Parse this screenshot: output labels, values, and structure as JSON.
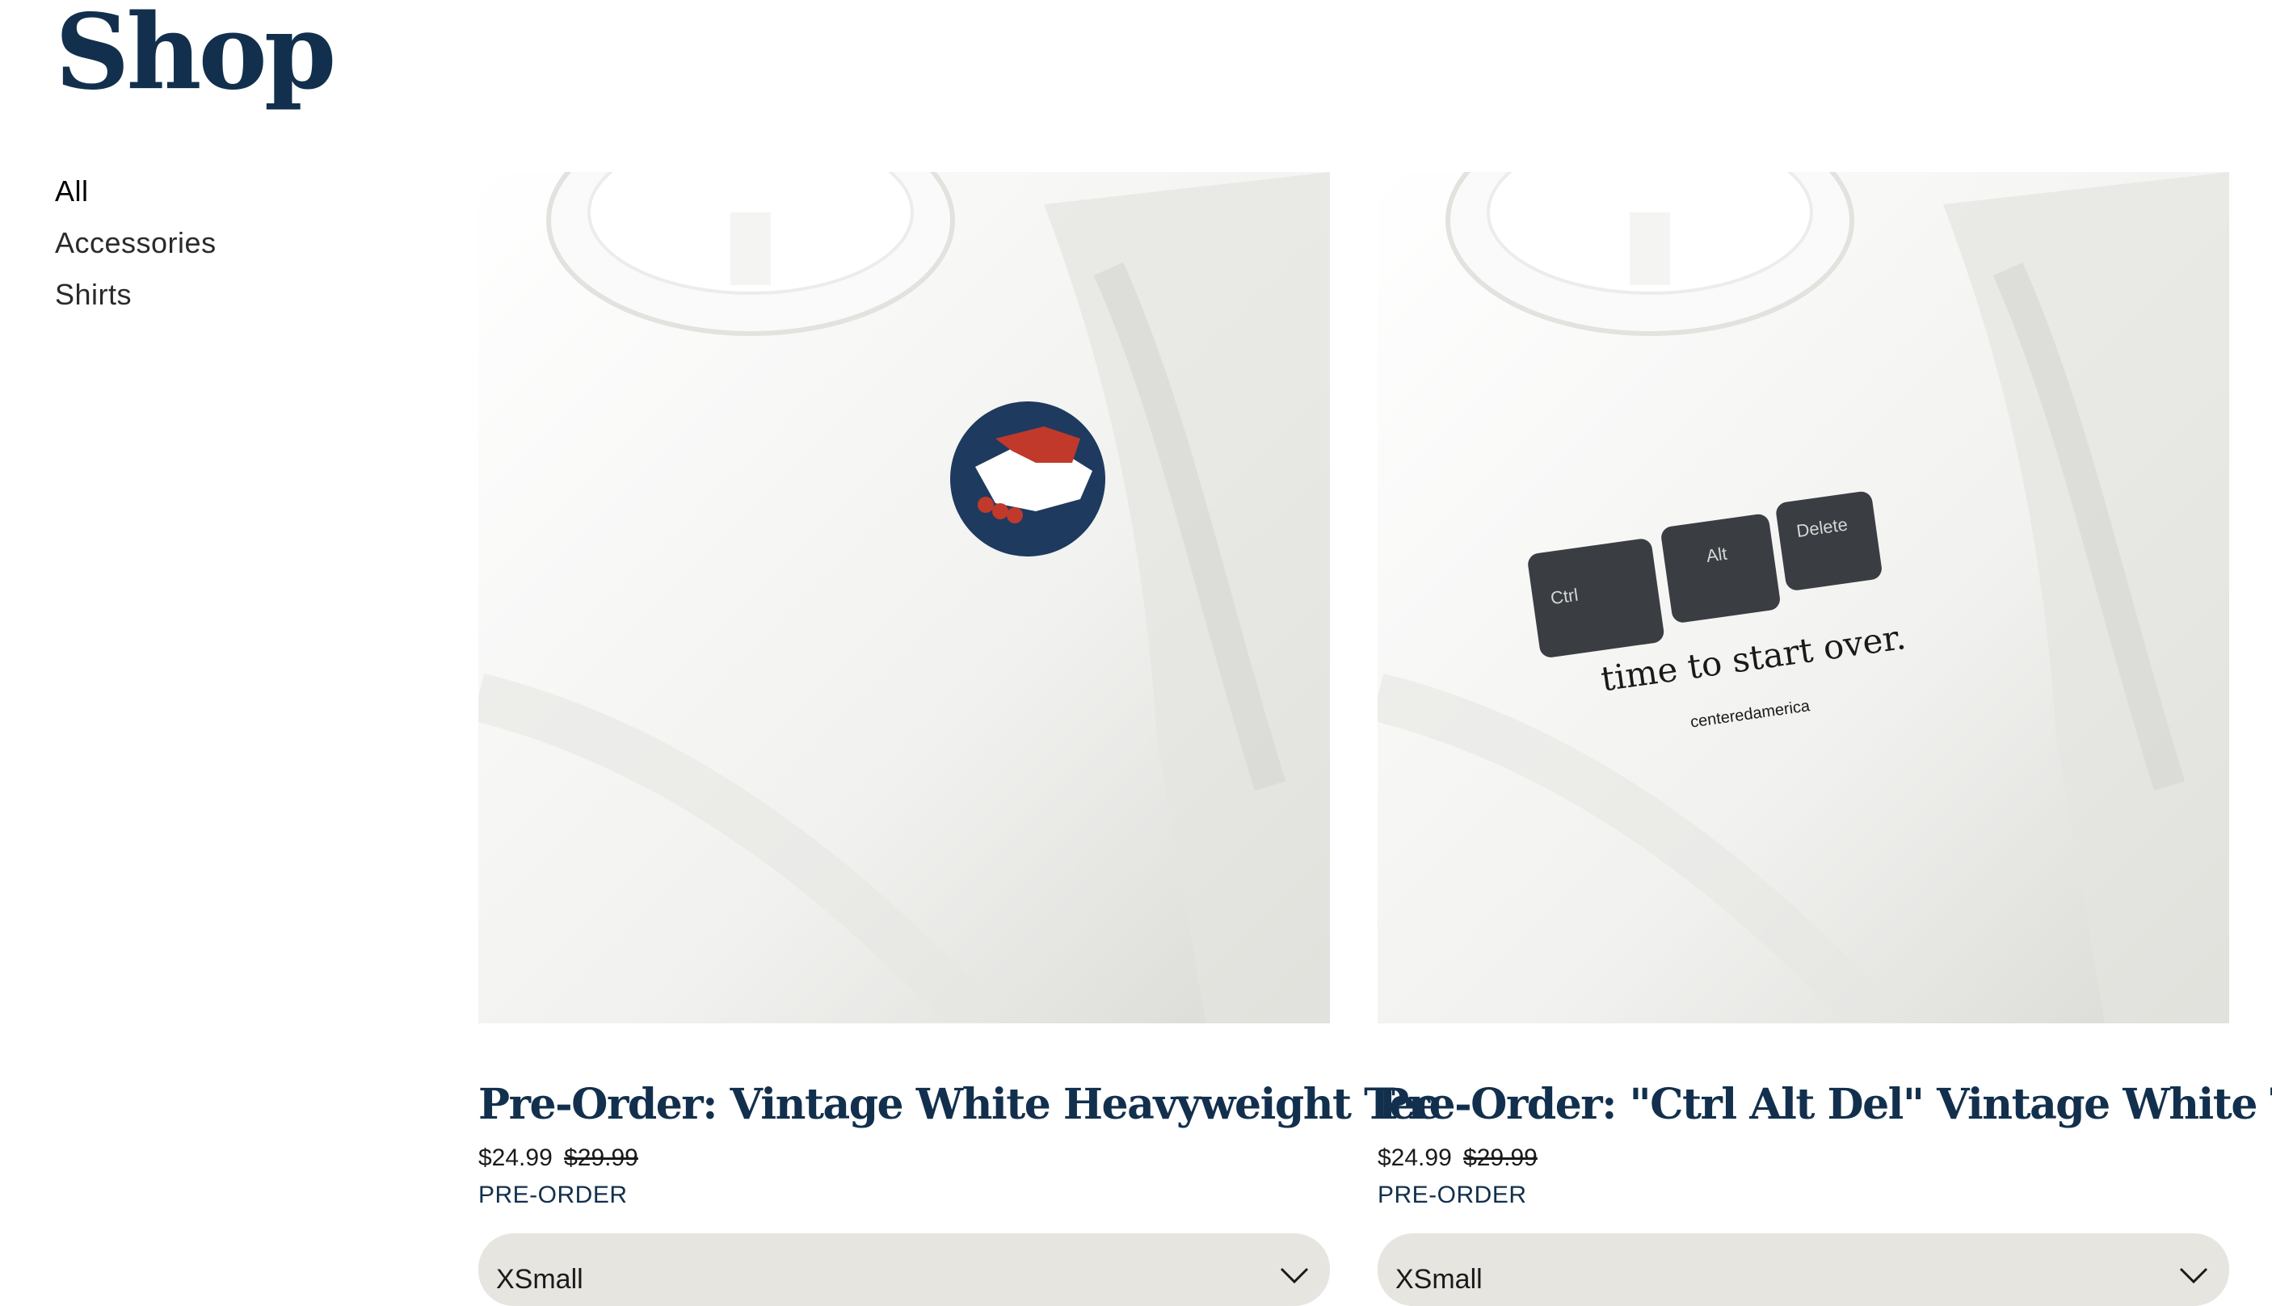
{
  "page": {
    "title": "Shop"
  },
  "categories": [
    {
      "label": "All",
      "active": true
    },
    {
      "label": "Accessories",
      "active": false
    },
    {
      "label": "Shirts",
      "active": false
    }
  ],
  "products": [
    {
      "name": "Pre-Order: Vintage White Heavyweight Tee",
      "price": "$24.99",
      "compare_price": "$29.99",
      "badge": "PRE-ORDER",
      "size_selected": "XSmall",
      "image_icon": "handshake-logo"
    },
    {
      "name": "Pre-Order: \"Ctrl Alt Del\" Vintage White Tee",
      "price": "$24.99",
      "compare_price": "$29.99",
      "badge": "PRE-ORDER",
      "size_selected": "XSmall",
      "image_icon": "keyboard-keys",
      "print": {
        "keys": [
          "Ctrl",
          "Alt",
          "Delete"
        ],
        "tagline": "time to start over.",
        "brand": "centeredamerica"
      }
    }
  ],
  "colors": {
    "brand_navy": "#12304d",
    "select_bg": "#e6e5e0",
    "accent_red": "#c0392b"
  }
}
